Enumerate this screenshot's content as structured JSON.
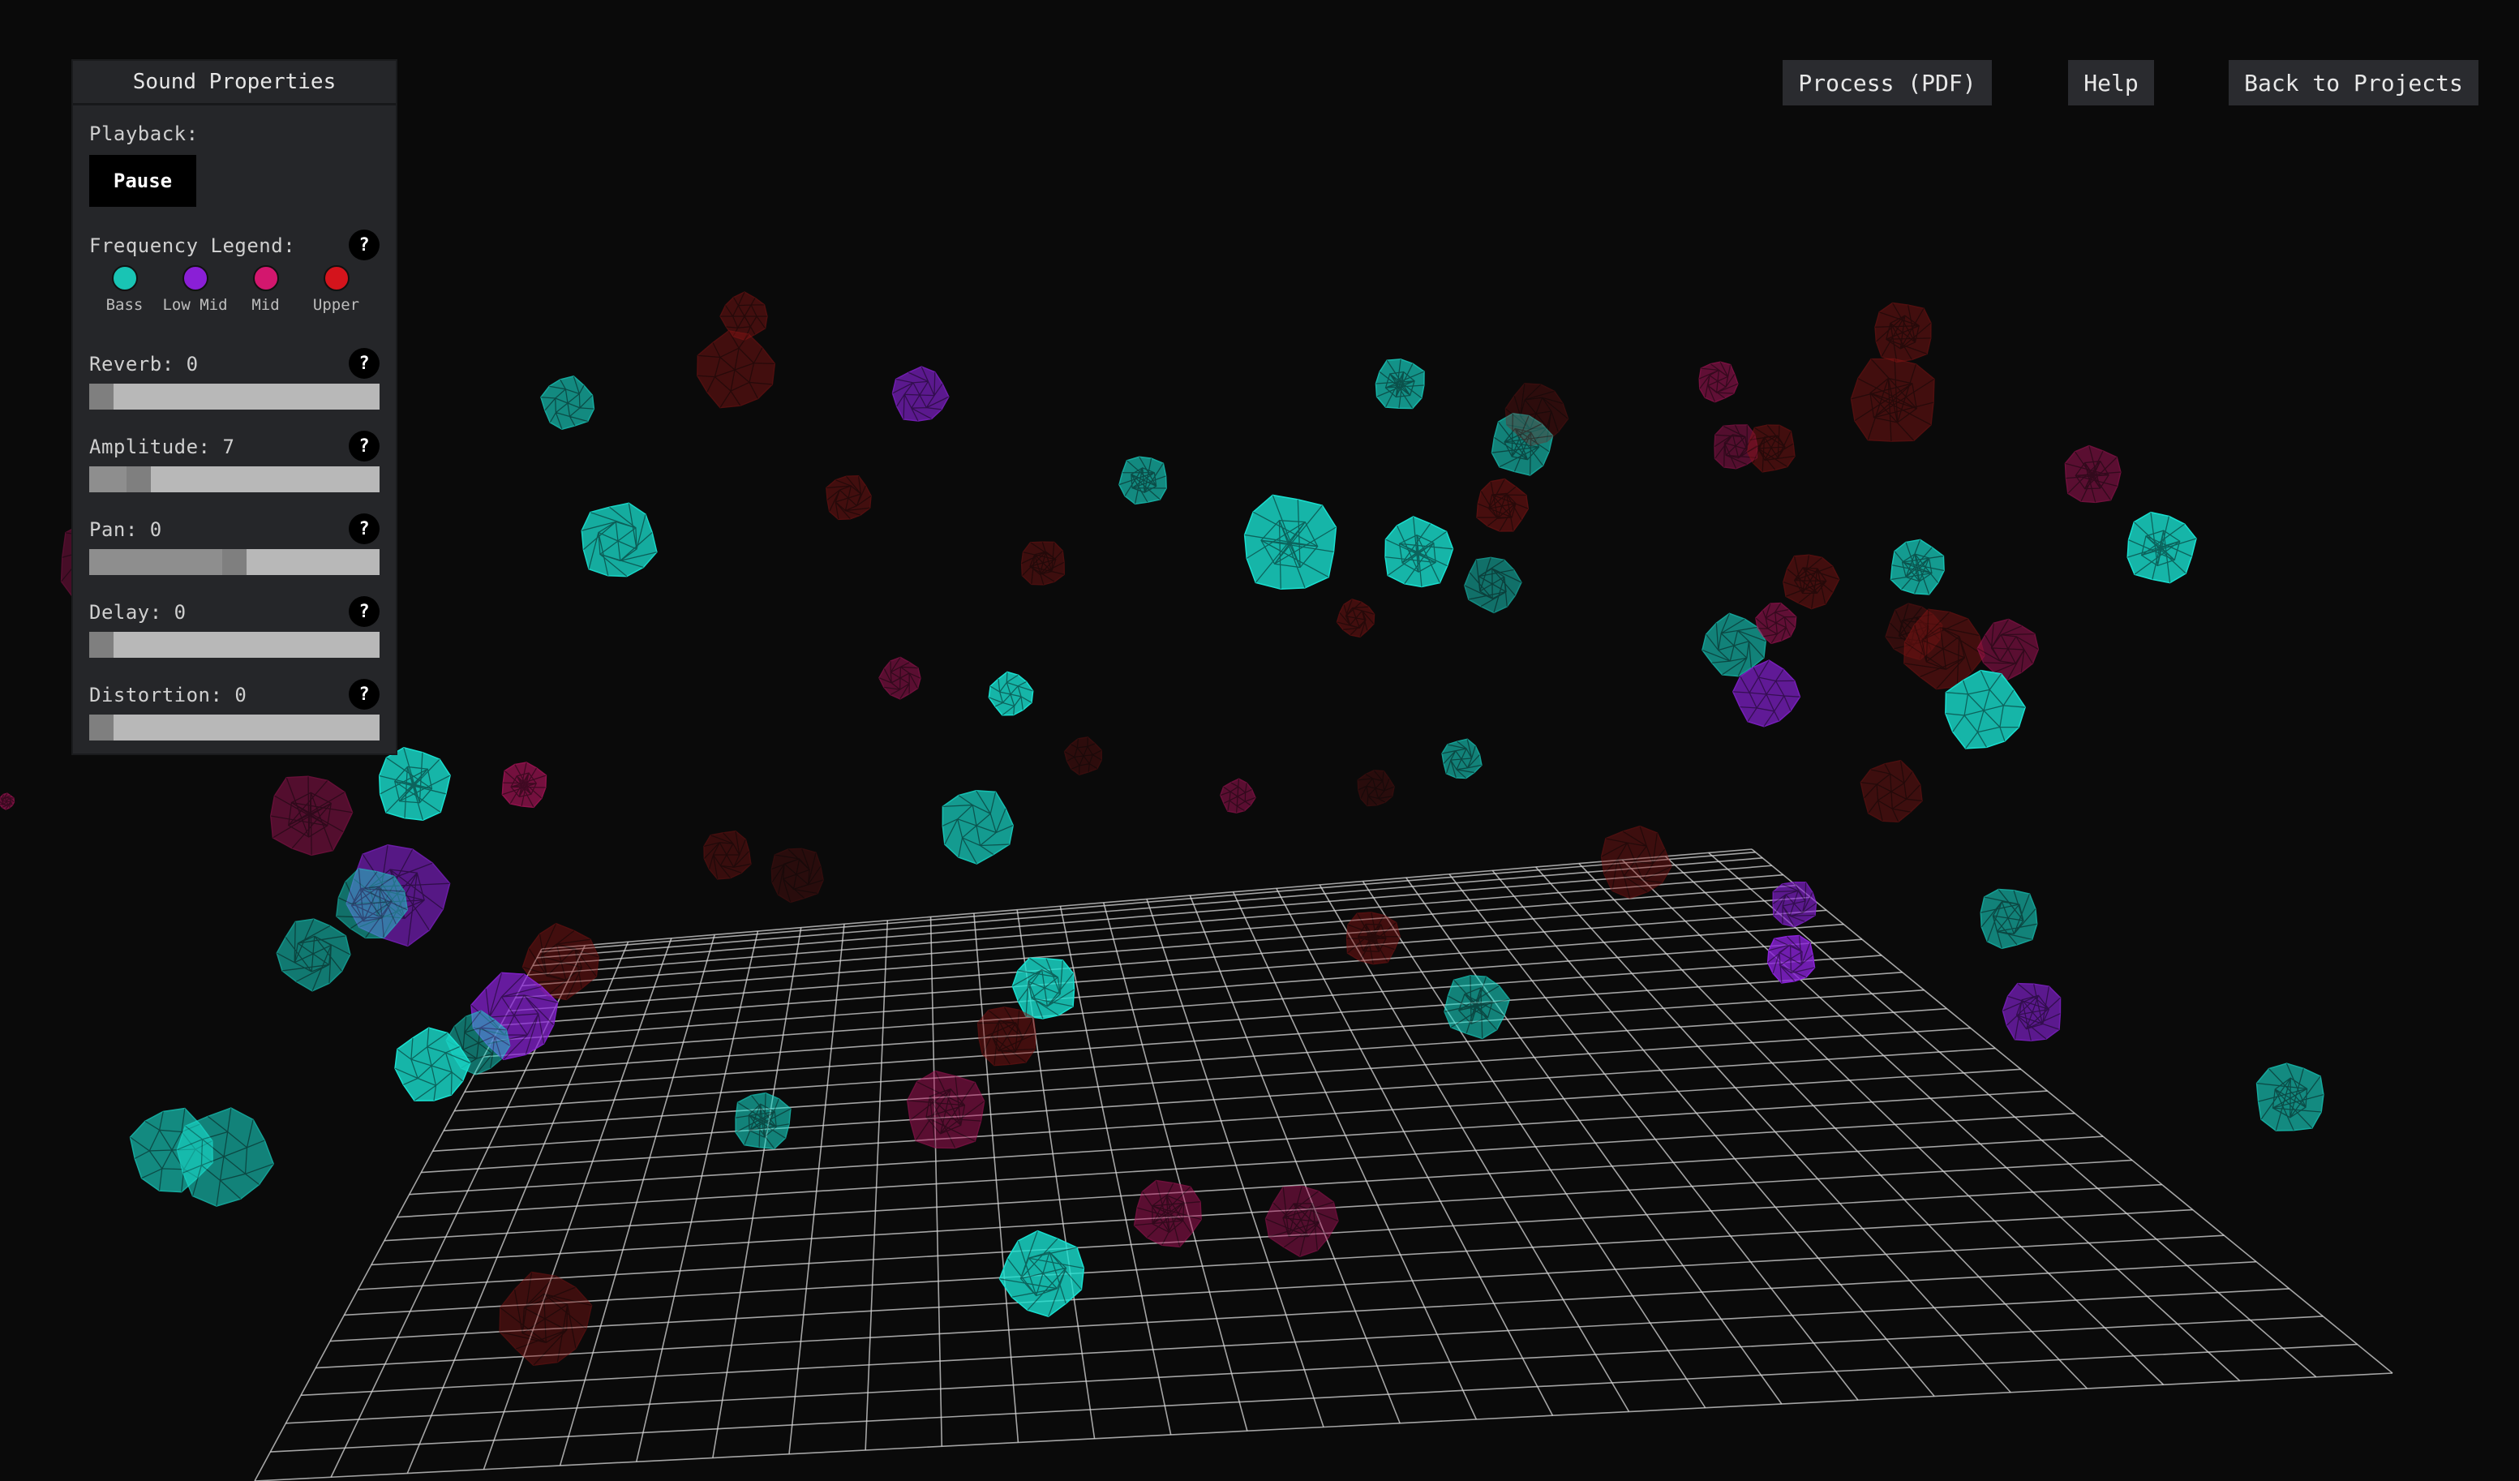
{
  "panel": {
    "title": "Sound Properties",
    "playback_label": "Playback:",
    "pause_label": "Pause",
    "legend_label": "Frequency Legend:",
    "legend": [
      {
        "name": "Bass",
        "color": "#19c4b4"
      },
      {
        "name": "Low Mid",
        "color": "#8a1fd6"
      },
      {
        "name": "Mid",
        "color": "#d3176e"
      },
      {
        "name": "Upper",
        "color": "#d4141c"
      }
    ],
    "help_glyph": "?",
    "sliders": [
      {
        "label": "Reverb: 0",
        "value": 0,
        "max": 100
      },
      {
        "label": "Amplitude: 7",
        "value": 7,
        "max": 50
      },
      {
        "label": "Pan: 0",
        "value": 0,
        "min": -100,
        "max": 100
      },
      {
        "label": "Delay: 0",
        "value": 0,
        "max": 100
      },
      {
        "label": "Distortion: 0",
        "value": 0,
        "max": 100
      }
    ]
  },
  "top_buttons": {
    "process": "Process (PDF)",
    "help": "Help",
    "back": "Back to Projects"
  },
  "colors": {
    "background": "#0a0a0a",
    "bass": "#19e0d0",
    "low_mid": "#8a22d8",
    "mid": "#b0145c",
    "upper": "#8a1414",
    "grid": "#d8d8d8"
  }
}
